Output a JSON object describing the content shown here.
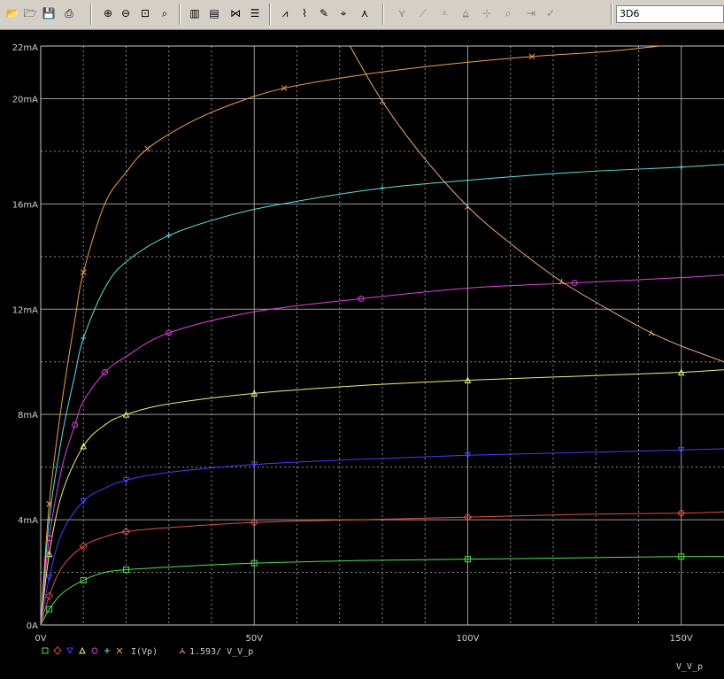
{
  "toolbar": {
    "icons": [
      "open-icon",
      "folder-icon",
      "save-icon",
      "print-icon",
      "zoom-in-icon",
      "zoom-out-icon",
      "zoom-area-icon",
      "zoom-fit-icon",
      "axis-settings-icon",
      "add-plot-icon",
      "add-trace-icon",
      "marker-icon",
      "fourier-icon",
      "performance-icon",
      "label-icon",
      "cursor-icon",
      "cursor-peak-icon",
      "cursor-trough-icon",
      "cursor-slope-icon",
      "cursor-min-icon",
      "cursor-max-icon",
      "cursor-point-icon",
      "cursor-search-icon",
      "cursor-next-icon",
      "cursor-mark-icon"
    ],
    "trace_field": "3D6"
  },
  "chart_data": {
    "type": "line",
    "xlim": [
      0,
      160
    ],
    "ylim": [
      0,
      22
    ],
    "x_ticks": [
      "0V",
      "50V",
      "100V",
      "150V"
    ],
    "x_tick_values": [
      0,
      50,
      100,
      150
    ],
    "y_ticks": [
      "0A",
      "4mA",
      "8mA",
      "12mA",
      "16mA",
      "20mA",
      "22mA"
    ],
    "y_tick_values": [
      0,
      4,
      8,
      12,
      16,
      20,
      22
    ],
    "xlabel": "V_V_p",
    "ylabel": "",
    "grid": true,
    "legend": {
      "placement": "bottom-left",
      "expression_1": "I(Vp)",
      "expression_2": "1.593/ V_V_p"
    },
    "series": [
      {
        "marker": "square",
        "color": "#50e050",
        "x": [
          0,
          2,
          5,
          10,
          15,
          20,
          30,
          50,
          75,
          100,
          125,
          150,
          160
        ],
        "values": [
          0,
          0.6,
          1.2,
          1.7,
          2.0,
          2.1,
          2.2,
          2.35,
          2.45,
          2.5,
          2.55,
          2.6,
          2.6
        ]
      },
      {
        "marker": "diamond",
        "color": "#e05040",
        "x": [
          0,
          2,
          5,
          10,
          15,
          20,
          30,
          50,
          75,
          100,
          125,
          150,
          160
        ],
        "values": [
          0,
          1.1,
          2.2,
          3.0,
          3.35,
          3.55,
          3.7,
          3.9,
          4.0,
          4.1,
          4.2,
          4.25,
          4.3
        ]
      },
      {
        "marker": "triangle-down",
        "color": "#4040ff",
        "x": [
          0,
          2,
          5,
          10,
          15,
          20,
          30,
          50,
          75,
          100,
          125,
          150,
          160
        ],
        "values": [
          0,
          1.8,
          3.5,
          4.7,
          5.2,
          5.5,
          5.8,
          6.1,
          6.3,
          6.45,
          6.55,
          6.65,
          6.7
        ]
      },
      {
        "marker": "triangle",
        "color": "#f0f080",
        "x": [
          0,
          2,
          5,
          10,
          15,
          20,
          30,
          50,
          75,
          100,
          125,
          150,
          160
        ],
        "values": [
          0,
          2.7,
          5.0,
          6.8,
          7.6,
          8.0,
          8.4,
          8.8,
          9.1,
          9.3,
          9.45,
          9.6,
          9.7
        ]
      },
      {
        "marker": "circle",
        "color": "#e040e0",
        "x": [
          0,
          2,
          5,
          8,
          10,
          15,
          20,
          30,
          50,
          75,
          100,
          125,
          150,
          160
        ],
        "values": [
          0,
          3.3,
          6.0,
          7.6,
          8.5,
          9.6,
          10.2,
          11.1,
          11.9,
          12.4,
          12.8,
          13.0,
          13.2,
          13.3
        ]
      },
      {
        "marker": "plus",
        "color": "#60e0e0",
        "x": [
          0,
          2,
          5,
          8,
          10,
          15,
          20,
          30,
          45,
          60,
          80,
          100,
          125,
          150,
          160
        ],
        "values": [
          0,
          4.0,
          7.2,
          9.5,
          10.9,
          12.8,
          13.8,
          14.8,
          15.6,
          16.1,
          16.6,
          16.9,
          17.2,
          17.4,
          17.5
        ]
      },
      {
        "marker": "x",
        "color": "#f0a050",
        "x": [
          0,
          2,
          5,
          8,
          10,
          15,
          20,
          25,
          35,
          45,
          57,
          75,
          95,
          115,
          133,
          145
        ],
        "values": [
          0,
          4.6,
          8.5,
          11.6,
          13.4,
          16.0,
          17.2,
          18.1,
          19.1,
          19.8,
          20.4,
          20.9,
          21.3,
          21.6,
          21.8,
          22.0
        ]
      },
      {
        "marker": "triangle-up",
        "color": "#f0a878",
        "x": [
          72.4,
          80,
          89,
          100,
          110,
          122,
          135,
          143,
          150,
          160
        ],
        "values": [
          22.0,
          19.9,
          17.9,
          15.9,
          14.5,
          13.05,
          11.8,
          11.1,
          10.6,
          10.0
        ]
      }
    ]
  }
}
